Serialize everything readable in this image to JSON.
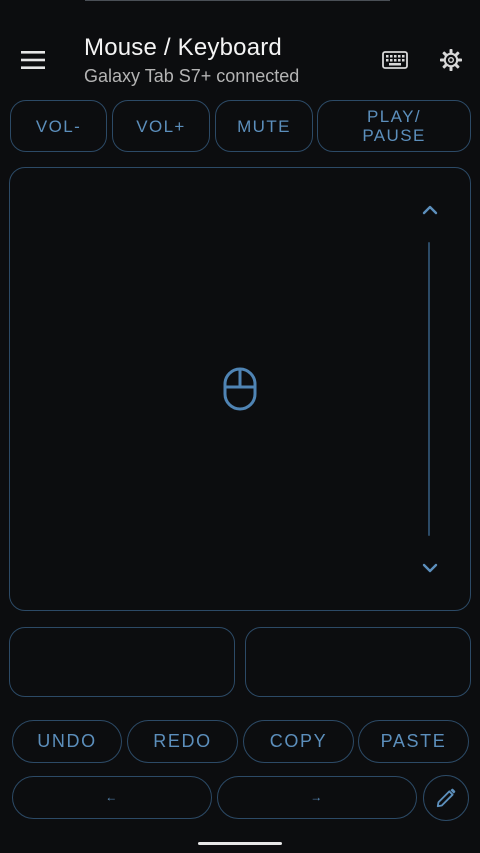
{
  "header": {
    "title": "Mouse / Keyboard",
    "subtitle": "Galaxy Tab S7+ connected",
    "icons": [
      "menu-icon",
      "keyboard-icon",
      "gear-icon"
    ]
  },
  "media_buttons": {
    "vol_down": "VOL-",
    "vol_up": "VOL+",
    "mute": "MUTE",
    "play_pause_line1": "PLAY/",
    "play_pause_line2": "PAUSE"
  },
  "touchpad": {
    "center_icon": "mouse-icon",
    "scroll_up_icon": "chevron-up-icon",
    "scroll_down_icon": "chevron-down-icon"
  },
  "edit_buttons": {
    "undo": "UNDO",
    "redo": "REDO",
    "copy": "COPY",
    "paste": "PASTE"
  },
  "arrow_buttons": {
    "left": "←",
    "right": "→",
    "pencil_icon": "pencil-icon"
  },
  "colors": {
    "background": "#0c0d0f",
    "accent": "#5c8fbc",
    "border": "#2c4a66",
    "title": "#f4f4f4",
    "subtitle": "#b4b4b4"
  }
}
